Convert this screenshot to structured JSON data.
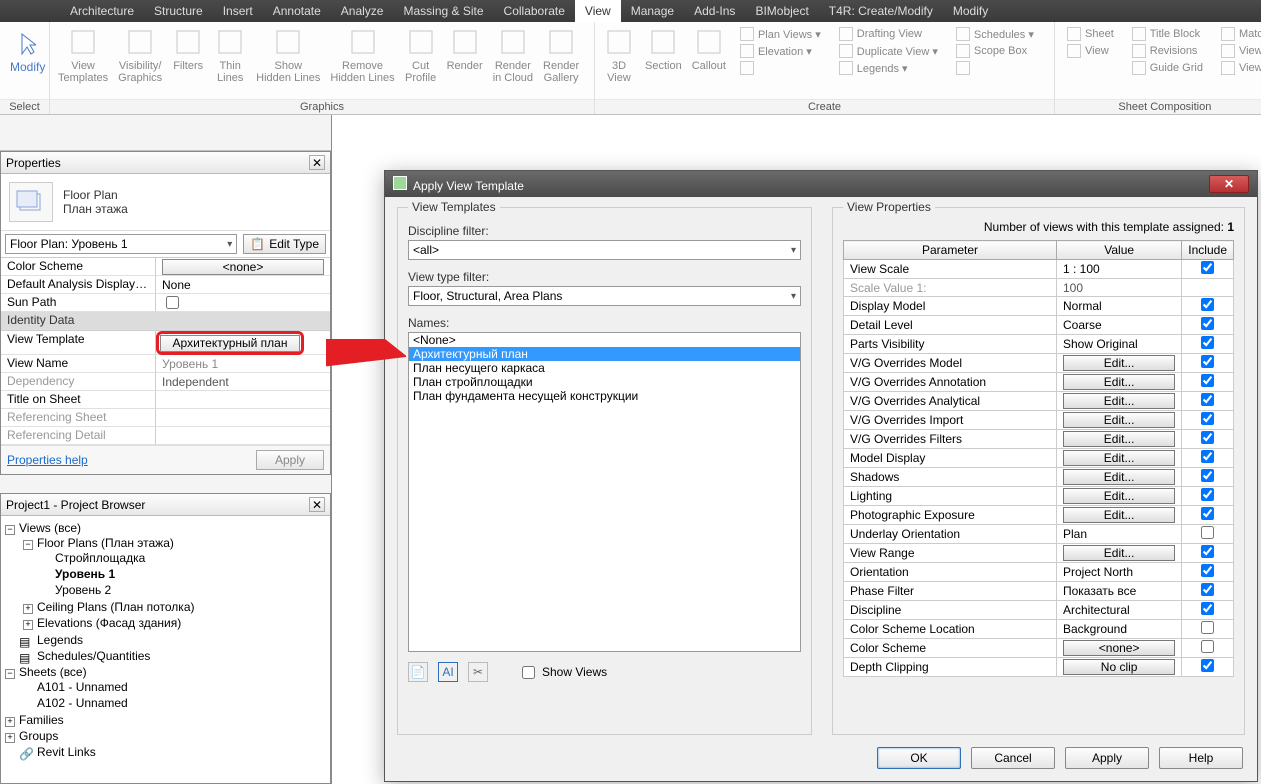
{
  "menu": {
    "items": [
      "Architecture",
      "Structure",
      "Insert",
      "Annotate",
      "Analyze",
      "Massing & Site",
      "Collaborate",
      "View",
      "Manage",
      "Add-Ins",
      "BIMobject",
      "T4R: Create/Modify",
      "Modify"
    ],
    "active": "View"
  },
  "ribbon": {
    "select": {
      "modify": "Modify",
      "label": "Select"
    },
    "graphics": {
      "label": "Graphics",
      "btns": [
        "View\nTemplates",
        "Visibility/\nGraphics",
        "Filters",
        "Thin\nLines",
        "Show\nHidden Lines",
        "Remove\nHidden Lines",
        "Cut\nProfile",
        "Render",
        "Render\nin Cloud",
        "Render\nGallery"
      ]
    },
    "create": {
      "label": "Create",
      "btns": [
        "3D\nView",
        "Section",
        "Callout"
      ],
      "mini": [
        "Plan Views ▾",
        "Elevation ▾",
        "Drafting View",
        "Duplicate View ▾",
        "Legends ▾",
        "Schedules ▾",
        "Scope Box"
      ]
    },
    "sheet": {
      "label": "Sheet Composition",
      "mini": [
        "Sheet",
        "View",
        "Title Block",
        "Revisions",
        "Guide Grid",
        "Matc",
        "View",
        "View"
      ]
    }
  },
  "properties": {
    "title": "Properties",
    "type_main": "Floor Plan",
    "type_sub": "План этажа",
    "instance": "Floor Plan: Уровень 1",
    "edit_type": "Edit Type",
    "rows": [
      {
        "label": "Color Scheme",
        "value": "<none>",
        "kind": "btn"
      },
      {
        "label": "Default Analysis Display …",
        "value": "None",
        "kind": "text"
      },
      {
        "label": "Sun Path",
        "value": "",
        "kind": "check"
      }
    ],
    "section": "Identity Data",
    "rows2": [
      {
        "label": "View Template",
        "value": "Архитектурный план",
        "kind": "highlight"
      },
      {
        "label": "View Name",
        "value": "Уровень 1",
        "kind": "text-dim"
      },
      {
        "label": "Dependency",
        "value": "Independent",
        "kind": "dim"
      },
      {
        "label": "Title on Sheet",
        "value": "",
        "kind": "text"
      },
      {
        "label": "Referencing Sheet",
        "value": "",
        "kind": "dim"
      },
      {
        "label": "Referencing Detail",
        "value": "",
        "kind": "dim"
      }
    ],
    "help": "Properties help",
    "apply": "Apply"
  },
  "browser": {
    "title": "Project1 - Project Browser",
    "tree": {
      "views": "Views (все)",
      "floor_plans": "Floor Plans (План этажа)",
      "fp_items": [
        "Стройплощадка",
        "Уровень 1",
        "Уровень 2"
      ],
      "ceiling": "Ceiling Plans (План потолка)",
      "elev": "Elevations (Фасад здания)",
      "legends": "Legends",
      "sched": "Schedules/Quantities",
      "sheets": "Sheets (все)",
      "sheet_items": [
        "A101 - Unnamed",
        "A102 - Unnamed"
      ],
      "families": "Families",
      "groups": "Groups",
      "links": "Revit Links"
    }
  },
  "dialog": {
    "title": "Apply View Template",
    "left": {
      "legend": "View Templates",
      "discipline_label": "Discipline filter:",
      "discipline_value": "<all>",
      "viewtype_label": "View type filter:",
      "viewtype_value": "Floor, Structural, Area Plans",
      "names_label": "Names:",
      "names": [
        "<None>",
        "Архитектурный план",
        "План несущего каркаса",
        "План стройплощадки",
        "План фундамента несущей конструкции"
      ],
      "selected": "Архитектурный план",
      "show_views": "Show Views"
    },
    "right": {
      "legend": "View Properties",
      "count_prefix": "Number of views with this template assigned:  ",
      "count": "1",
      "cols": [
        "Parameter",
        "Value",
        "Include"
      ],
      "rows": [
        {
          "p": "View Scale",
          "v": "1 : 100",
          "t": "text",
          "c": true
        },
        {
          "p": "Scale Value   1:",
          "v": "100",
          "t": "dim",
          "c": null
        },
        {
          "p": "Display Model",
          "v": "Normal",
          "t": "text",
          "c": true
        },
        {
          "p": "Detail Level",
          "v": "Coarse",
          "t": "text",
          "c": true
        },
        {
          "p": "Parts Visibility",
          "v": "Show Original",
          "t": "text",
          "c": true
        },
        {
          "p": "V/G Overrides Model",
          "v": "Edit...",
          "t": "btn",
          "c": true
        },
        {
          "p": "V/G Overrides Annotation",
          "v": "Edit...",
          "t": "btn",
          "c": true
        },
        {
          "p": "V/G Overrides Analytical",
          "v": "Edit...",
          "t": "btn",
          "c": true
        },
        {
          "p": "V/G Overrides Import",
          "v": "Edit...",
          "t": "btn",
          "c": true
        },
        {
          "p": "V/G Overrides Filters",
          "v": "Edit...",
          "t": "btn",
          "c": true
        },
        {
          "p": "Model Display",
          "v": "Edit...",
          "t": "btn",
          "c": true
        },
        {
          "p": "Shadows",
          "v": "Edit...",
          "t": "btn",
          "c": true
        },
        {
          "p": "Lighting",
          "v": "Edit...",
          "t": "btn",
          "c": true
        },
        {
          "p": "Photographic Exposure",
          "v": "Edit...",
          "t": "btn",
          "c": true
        },
        {
          "p": "Underlay Orientation",
          "v": "Plan",
          "t": "text",
          "c": false
        },
        {
          "p": "View Range",
          "v": "Edit...",
          "t": "btn",
          "c": true
        },
        {
          "p": "Orientation",
          "v": "Project North",
          "t": "text",
          "c": true
        },
        {
          "p": "Phase Filter",
          "v": "Показать все",
          "t": "text",
          "c": true
        },
        {
          "p": "Discipline",
          "v": "Architectural",
          "t": "text",
          "c": true
        },
        {
          "p": "Color Scheme Location",
          "v": "Background",
          "t": "text",
          "c": false
        },
        {
          "p": "Color Scheme",
          "v": "<none>",
          "t": "btn",
          "c": false
        },
        {
          "p": "Depth Clipping",
          "v": "No clip",
          "t": "btn",
          "c": true
        }
      ]
    },
    "buttons": {
      "ok": "OK",
      "cancel": "Cancel",
      "apply": "Apply",
      "help": "Help"
    }
  }
}
